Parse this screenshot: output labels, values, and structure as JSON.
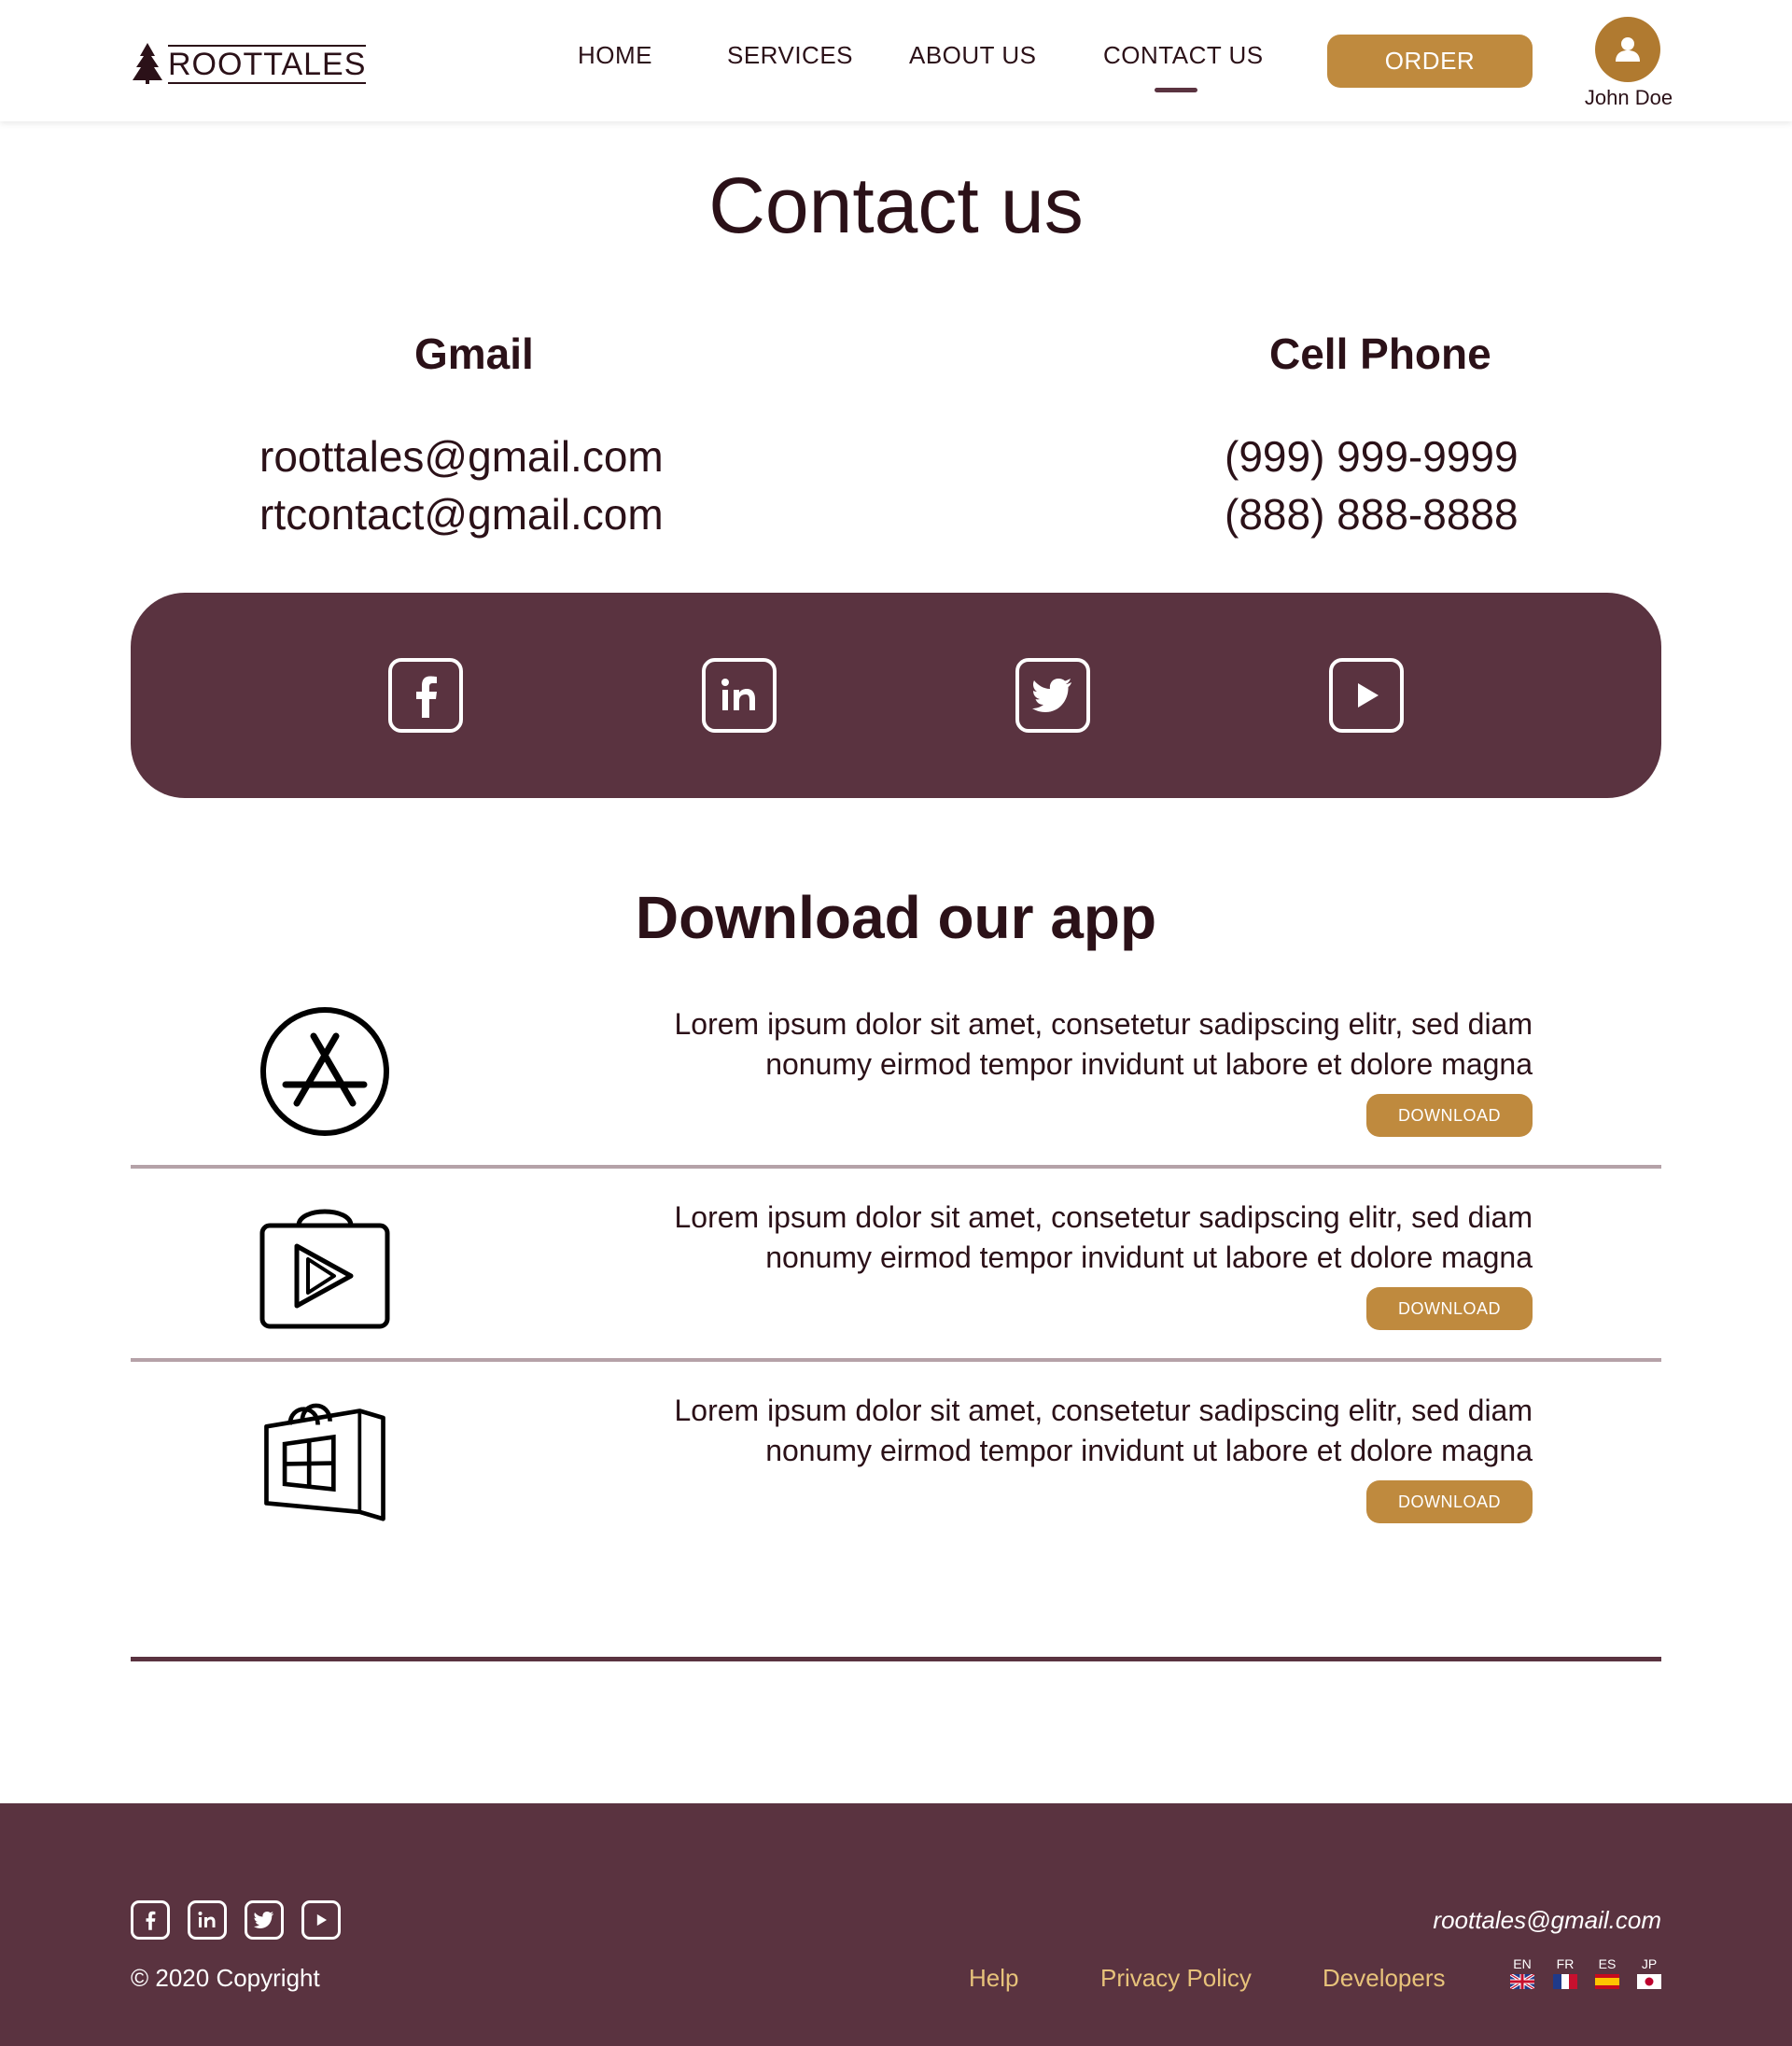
{
  "header": {
    "logo_text": "ROOTTALES",
    "nav": [
      {
        "label": "HOME"
      },
      {
        "label": "SERVICES"
      },
      {
        "label": "ABOUT US"
      },
      {
        "label": "CONTACT US",
        "active": true
      }
    ],
    "order_label": "ORDER",
    "user_name": "John Doe"
  },
  "contact": {
    "title": "Contact us",
    "gmail_title": "Gmail",
    "emails": [
      "roottales@gmail.com",
      "rtcontact@gmail.com"
    ],
    "phone_title": "Cell Phone",
    "phones": [
      "(999) 999-9999",
      "(888) 888-8888"
    ]
  },
  "social": [
    "facebook-icon",
    "linkedin-icon",
    "twitter-icon",
    "youtube-icon"
  ],
  "download": {
    "title": "Download our app",
    "apps": [
      {
        "icon": "app-store-icon",
        "line1": "Lorem ipsum dolor sit amet, consetetur sadipscing elitr, sed diam",
        "line2": "nonumy eirmod tempor invidunt ut labore et dolore magna",
        "button": "DOWNLOAD"
      },
      {
        "icon": "google-play-icon",
        "line1": "Lorem ipsum dolor sit amet, consetetur sadipscing elitr, sed diam",
        "line2": "nonumy eirmod tempor invidunt ut labore et dolore magna",
        "button": "DOWNLOAD"
      },
      {
        "icon": "microsoft-store-icon",
        "line1": "Lorem ipsum dolor sit amet, consetetur sadipscing elitr, sed diam",
        "line2": "nonumy eirmod tempor invidunt ut labore et dolore magna",
        "button": "DOWNLOAD"
      }
    ]
  },
  "footer": {
    "copyright": "© 2020 Copyright",
    "email": "roottales@gmail.com",
    "links": [
      "Help",
      "Privacy Policy",
      "Developers"
    ],
    "languages": [
      "EN",
      "FR",
      "ES",
      "JP"
    ]
  },
  "colors": {
    "brand_maroon": "#5a3340",
    "accent_gold": "#bf8a3e",
    "text_dark": "#2b1118",
    "footer_link": "#e7c27a"
  }
}
